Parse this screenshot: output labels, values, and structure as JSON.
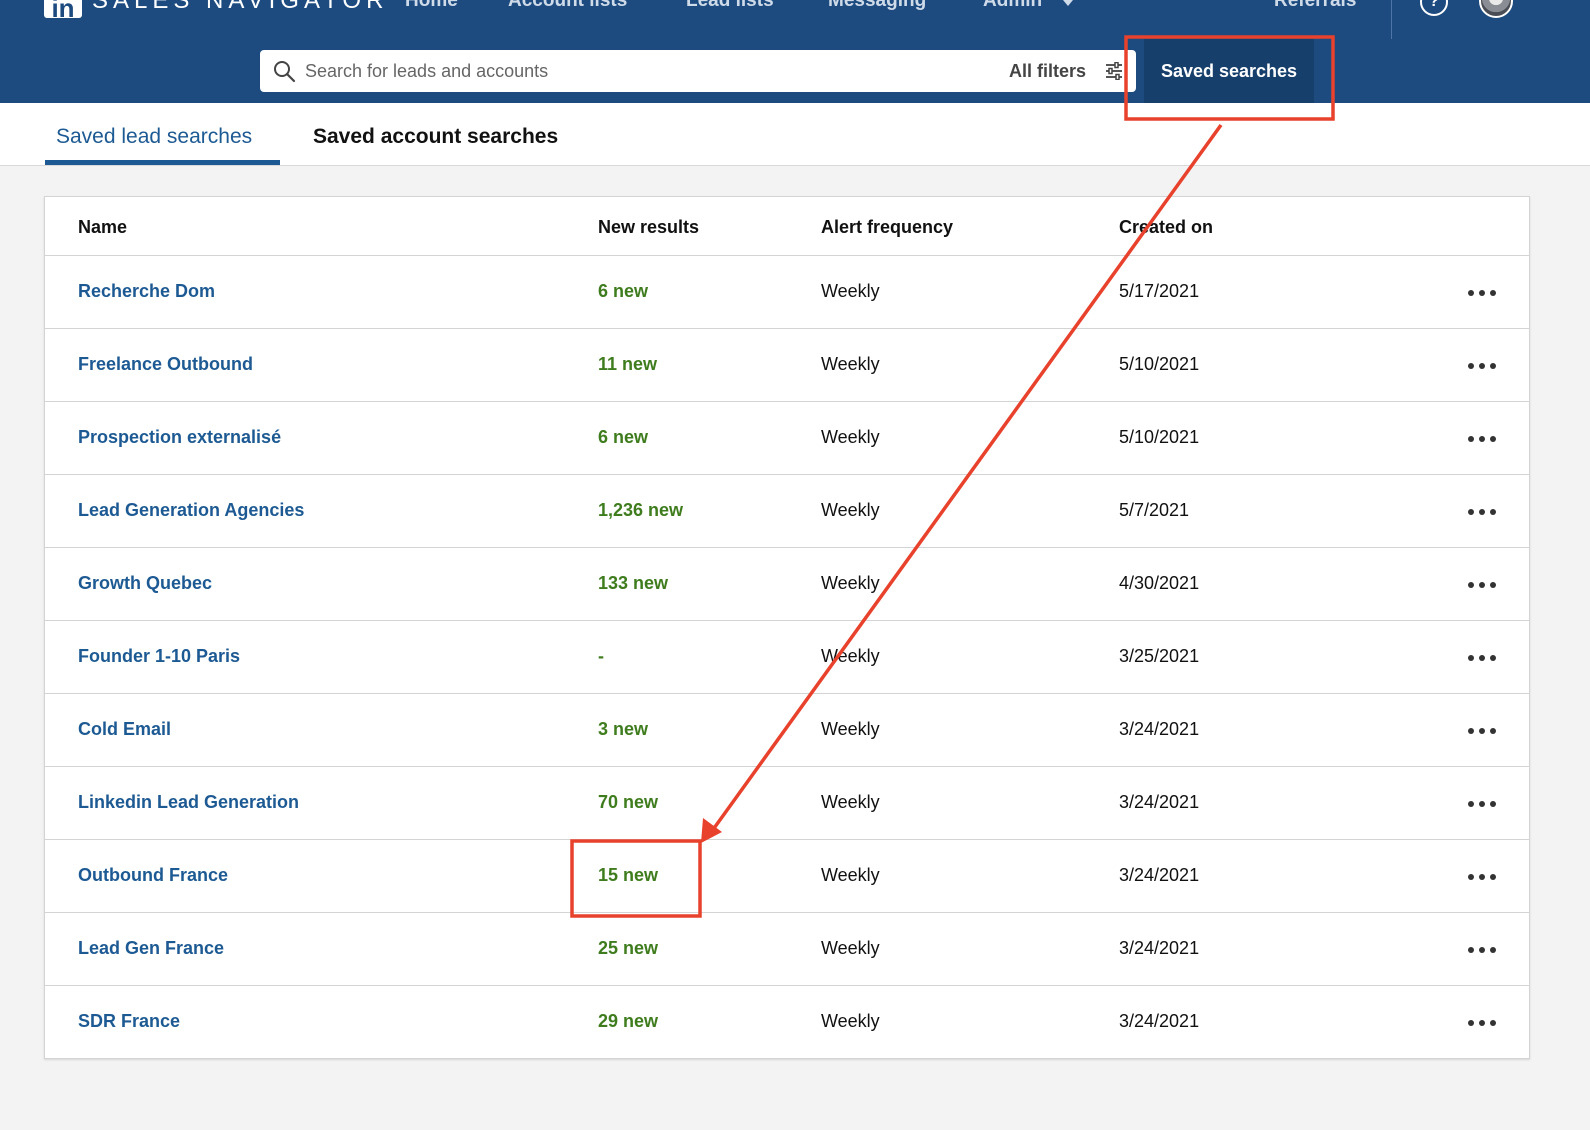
{
  "nav": {
    "brand_logo": "in",
    "brand_name": "SALES NAVIGATOR",
    "links": [
      "Home",
      "Account lists",
      "Lead lists",
      "Messaging",
      "Admin"
    ],
    "referrals": "Referrals",
    "help_icon": "?"
  },
  "search": {
    "placeholder": "Search for leads and accounts",
    "filters_label": "All filters",
    "saved_searches_label": "Saved searches"
  },
  "tabs": {
    "active": "Saved lead searches",
    "inactive": "Saved account searches"
  },
  "table": {
    "headers": {
      "name": "Name",
      "new_results": "New results",
      "alert_frequency": "Alert frequency",
      "created_on": "Created on"
    },
    "rows": [
      {
        "name": "Recherche Dom",
        "new": "6 new",
        "freq": "Weekly",
        "created": "5/17/2021"
      },
      {
        "name": "Freelance Outbound",
        "new": "11 new",
        "freq": "Weekly",
        "created": "5/10/2021"
      },
      {
        "name": "Prospection externalisé",
        "new": "6 new",
        "freq": "Weekly",
        "created": "5/10/2021"
      },
      {
        "name": "Lead Generation Agencies",
        "new": "1,236 new",
        "freq": "Weekly",
        "created": "5/7/2021"
      },
      {
        "name": "Growth Quebec",
        "new": "133 new",
        "freq": "Weekly",
        "created": "4/30/2021"
      },
      {
        "name": "Founder 1-10 Paris",
        "new": "-",
        "freq": "Weekly",
        "created": "3/25/2021"
      },
      {
        "name": "Cold Email",
        "new": "3 new",
        "freq": "Weekly",
        "created": "3/24/2021"
      },
      {
        "name": "Linkedin Lead Generation",
        "new": "70 new",
        "freq": "Weekly",
        "created": "3/24/2021"
      },
      {
        "name": "Outbound France",
        "new": "15 new",
        "freq": "Weekly",
        "created": "3/24/2021"
      },
      {
        "name": "Lead Gen France",
        "new": "25 new",
        "freq": "Weekly",
        "created": "3/24/2021"
      },
      {
        "name": "SDR France",
        "new": "29 new",
        "freq": "Weekly",
        "created": "3/24/2021"
      }
    ]
  },
  "colors": {
    "nav_bg": "#1d4b80",
    "link_blue": "#1d5a93",
    "new_green": "#3e7c1d",
    "annotation_red": "#e8412c"
  }
}
